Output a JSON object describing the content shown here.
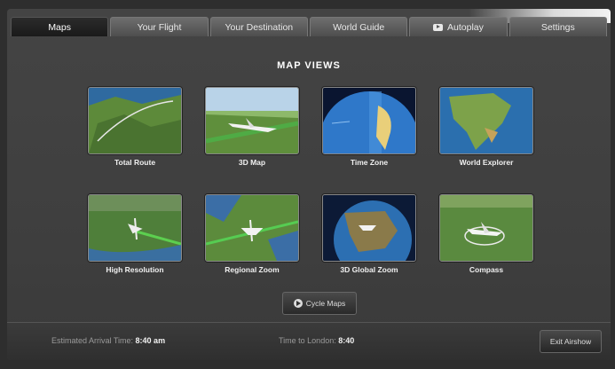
{
  "tabs": [
    {
      "label": "Maps",
      "active": true
    },
    {
      "label": "Your Flight"
    },
    {
      "label": "Your Destination"
    },
    {
      "label": "World Guide"
    },
    {
      "label": "Autoplay"
    },
    {
      "label": "Settings"
    }
  ],
  "page_title": "MAP VIEWS",
  "tiles": [
    {
      "label": "Total Route",
      "icon": "total-route-thumbnail"
    },
    {
      "label": "3D Map",
      "icon": "3d-map-thumbnail"
    },
    {
      "label": "Time Zone",
      "icon": "time-zone-thumbnail"
    },
    {
      "label": "World Explorer",
      "icon": "world-explorer-thumbnail"
    },
    {
      "label": "High Resolution",
      "icon": "high-resolution-thumbnail"
    },
    {
      "label": "Regional Zoom",
      "icon": "regional-zoom-thumbnail"
    },
    {
      "label": "3D Global Zoom",
      "icon": "3d-global-zoom-thumbnail"
    },
    {
      "label": "Compass",
      "icon": "compass-thumbnail"
    }
  ],
  "cycle_label": "Cycle Maps",
  "footer": {
    "arrival_label": "Estimated Arrival Time:",
    "arrival_value": "8:40 am",
    "time_label": "Time to London:",
    "time_value": "8:40",
    "exit_label": "Exit Airshow"
  },
  "colors": {
    "frame_bg": "#3f3f3f",
    "active_tab": "#1a1a1a",
    "tab": "#5e5e5e"
  }
}
